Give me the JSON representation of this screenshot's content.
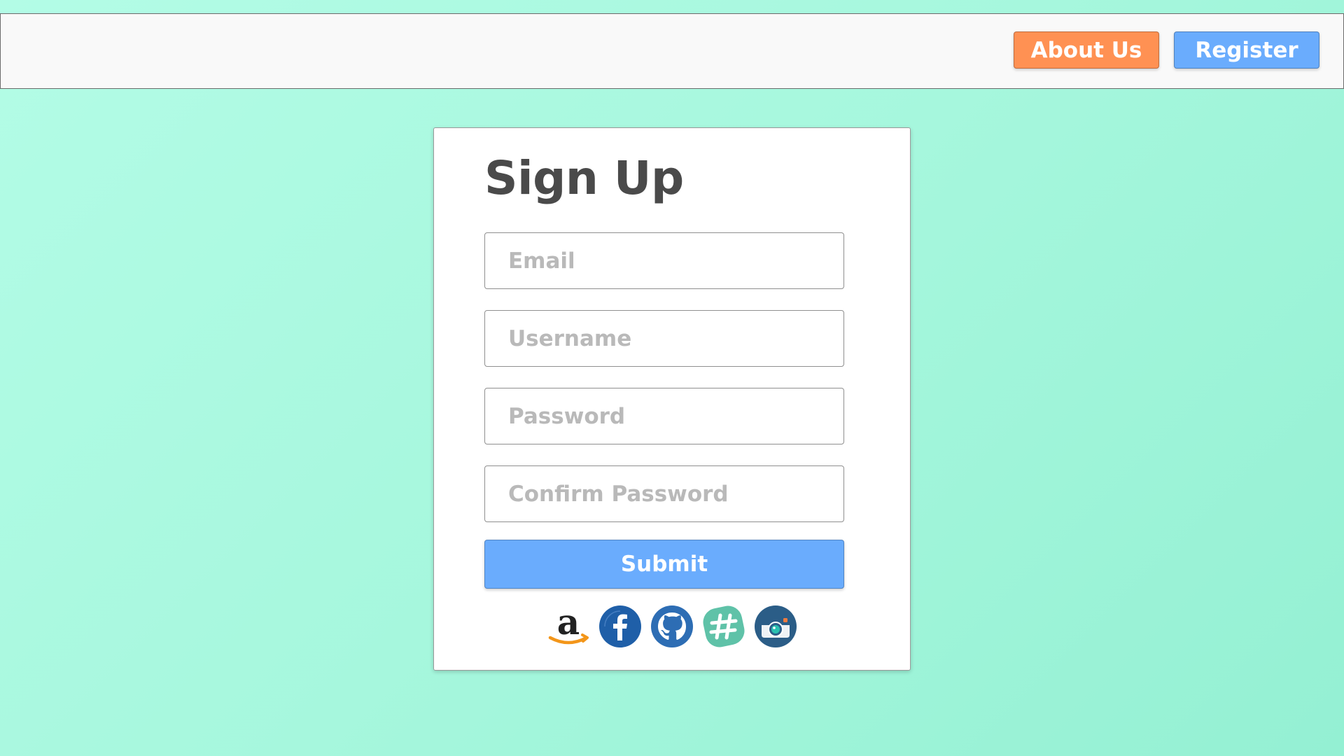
{
  "colors": {
    "about_button": "#ff9153",
    "register_button": "#6aacfd",
    "submit_button": "#6aacfd",
    "title_text": "#4a4a4a",
    "placeholder_text": "#b9b9b9"
  },
  "topbar": {
    "about_label": "About Us",
    "register_label": "Register"
  },
  "signup": {
    "title": "Sign Up",
    "email_placeholder": "Email",
    "username_placeholder": "Username",
    "password_placeholder": "Password",
    "confirm_placeholder": "Confirm Password",
    "submit_label": "Submit"
  },
  "social_icons": [
    "amazon-icon",
    "facebook-icon",
    "github-icon",
    "slack-icon",
    "instagram-icon"
  ]
}
